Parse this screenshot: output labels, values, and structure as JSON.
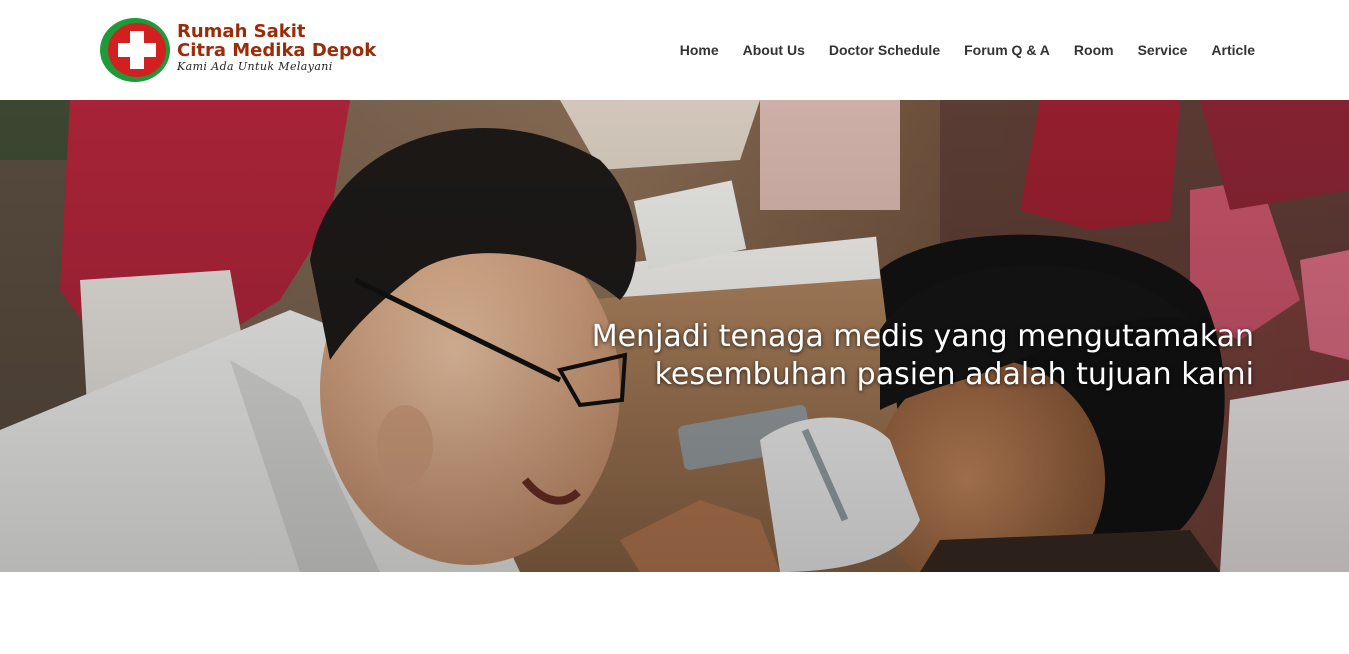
{
  "brand": {
    "name_line1": "Rumah Sakit",
    "name_line2": "Citra Medika Depok",
    "tagline": "Kami Ada Untuk Melayani",
    "colors": {
      "logo_red": "#d21f1f",
      "logo_green": "#1e9a3a",
      "logo_text": "#9b2c0a"
    }
  },
  "nav": {
    "items": [
      {
        "label": "Home"
      },
      {
        "label": "About Us"
      },
      {
        "label": "Doctor Schedule"
      },
      {
        "label": "Forum Q & A"
      },
      {
        "label": "Room"
      },
      {
        "label": "Service"
      },
      {
        "label": "Article"
      }
    ]
  },
  "hero": {
    "image": "doctor-examining-child-photo",
    "caption_line1": "Menjadi tenaga medis yang mengutamakan",
    "caption_line2": "kesembuhan pasien adalah tujuan kami"
  }
}
